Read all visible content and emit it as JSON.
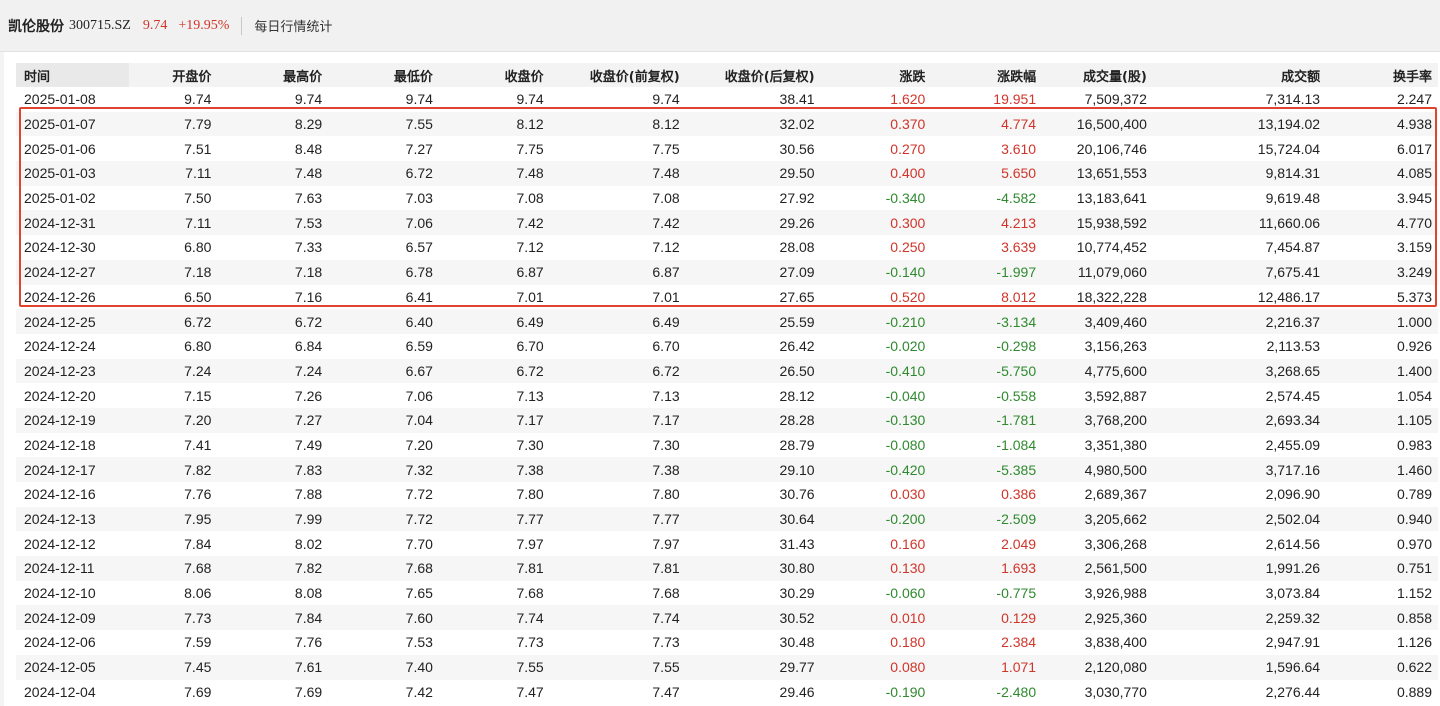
{
  "header": {
    "stock_name": "凯伦股份",
    "stock_code": "300715.SZ",
    "price": "9.74",
    "change_pct": "+19.95%",
    "tab_label": "每日行情统计"
  },
  "colors": {
    "up": "#d0352a",
    "down": "#2f8a2f",
    "highlight": "#e0442e"
  },
  "table": {
    "columns": [
      "时间",
      "开盘价",
      "最高价",
      "最低价",
      "收盘价",
      "收盘价(前复权)",
      "收盘价(后复权)",
      "涨跌",
      "涨跌幅",
      "成交量(股)",
      "成交额",
      "换手率"
    ],
    "rows": [
      [
        "2025-01-08",
        "9.74",
        "9.74",
        "9.74",
        "9.74",
        "9.74",
        "38.41",
        "1.620",
        "19.951",
        "7,509,372",
        "7,314.13",
        "2.247"
      ],
      [
        "2025-01-07",
        "7.79",
        "8.29",
        "7.55",
        "8.12",
        "8.12",
        "32.02",
        "0.370",
        "4.774",
        "16,500,400",
        "13,194.02",
        "4.938"
      ],
      [
        "2025-01-06",
        "7.51",
        "8.48",
        "7.27",
        "7.75",
        "7.75",
        "30.56",
        "0.270",
        "3.610",
        "20,106,746",
        "15,724.04",
        "6.017"
      ],
      [
        "2025-01-03",
        "7.11",
        "7.48",
        "6.72",
        "7.48",
        "7.48",
        "29.50",
        "0.400",
        "5.650",
        "13,651,553",
        "9,814.31",
        "4.085"
      ],
      [
        "2025-01-02",
        "7.50",
        "7.63",
        "7.03",
        "7.08",
        "7.08",
        "27.92",
        "-0.340",
        "-4.582",
        "13,183,641",
        "9,619.48",
        "3.945"
      ],
      [
        "2024-12-31",
        "7.11",
        "7.53",
        "7.06",
        "7.42",
        "7.42",
        "29.26",
        "0.300",
        "4.213",
        "15,938,592",
        "11,660.06",
        "4.770"
      ],
      [
        "2024-12-30",
        "6.80",
        "7.33",
        "6.57",
        "7.12",
        "7.12",
        "28.08",
        "0.250",
        "3.639",
        "10,774,452",
        "7,454.87",
        "3.159"
      ],
      [
        "2024-12-27",
        "7.18",
        "7.18",
        "6.78",
        "6.87",
        "6.87",
        "27.09",
        "-0.140",
        "-1.997",
        "11,079,060",
        "7,675.41",
        "3.249"
      ],
      [
        "2024-12-26",
        "6.50",
        "7.16",
        "6.41",
        "7.01",
        "7.01",
        "27.65",
        "0.520",
        "8.012",
        "18,322,228",
        "12,486.17",
        "5.373"
      ],
      [
        "2024-12-25",
        "6.72",
        "6.72",
        "6.40",
        "6.49",
        "6.49",
        "25.59",
        "-0.210",
        "-3.134",
        "3,409,460",
        "2,216.37",
        "1.000"
      ],
      [
        "2024-12-24",
        "6.80",
        "6.84",
        "6.59",
        "6.70",
        "6.70",
        "26.42",
        "-0.020",
        "-0.298",
        "3,156,263",
        "2,113.53",
        "0.926"
      ],
      [
        "2024-12-23",
        "7.24",
        "7.24",
        "6.67",
        "6.72",
        "6.72",
        "26.50",
        "-0.410",
        "-5.750",
        "4,775,600",
        "3,268.65",
        "1.400"
      ],
      [
        "2024-12-20",
        "7.15",
        "7.26",
        "7.06",
        "7.13",
        "7.13",
        "28.12",
        "-0.040",
        "-0.558",
        "3,592,887",
        "2,574.45",
        "1.054"
      ],
      [
        "2024-12-19",
        "7.20",
        "7.27",
        "7.04",
        "7.17",
        "7.17",
        "28.28",
        "-0.130",
        "-1.781",
        "3,768,200",
        "2,693.34",
        "1.105"
      ],
      [
        "2024-12-18",
        "7.41",
        "7.49",
        "7.20",
        "7.30",
        "7.30",
        "28.79",
        "-0.080",
        "-1.084",
        "3,351,380",
        "2,455.09",
        "0.983"
      ],
      [
        "2024-12-17",
        "7.82",
        "7.83",
        "7.32",
        "7.38",
        "7.38",
        "29.10",
        "-0.420",
        "-5.385",
        "4,980,500",
        "3,717.16",
        "1.460"
      ],
      [
        "2024-12-16",
        "7.76",
        "7.88",
        "7.72",
        "7.80",
        "7.80",
        "30.76",
        "0.030",
        "0.386",
        "2,689,367",
        "2,096.90",
        "0.789"
      ],
      [
        "2024-12-13",
        "7.95",
        "7.99",
        "7.72",
        "7.77",
        "7.77",
        "30.64",
        "-0.200",
        "-2.509",
        "3,205,662",
        "2,502.04",
        "0.940"
      ],
      [
        "2024-12-12",
        "7.84",
        "8.02",
        "7.70",
        "7.97",
        "7.97",
        "31.43",
        "0.160",
        "2.049",
        "3,306,268",
        "2,614.56",
        "0.970"
      ],
      [
        "2024-12-11",
        "7.68",
        "7.82",
        "7.68",
        "7.81",
        "7.81",
        "30.80",
        "0.130",
        "1.693",
        "2,561,500",
        "1,991.26",
        "0.751"
      ],
      [
        "2024-12-10",
        "8.06",
        "8.08",
        "7.65",
        "7.68",
        "7.68",
        "30.29",
        "-0.060",
        "-0.775",
        "3,926,988",
        "3,073.84",
        "1.152"
      ],
      [
        "2024-12-09",
        "7.73",
        "7.84",
        "7.60",
        "7.74",
        "7.74",
        "30.52",
        "0.010",
        "0.129",
        "2,925,360",
        "2,259.32",
        "0.858"
      ],
      [
        "2024-12-06",
        "7.59",
        "7.76",
        "7.53",
        "7.73",
        "7.73",
        "30.48",
        "0.180",
        "2.384",
        "3,838,400",
        "2,947.91",
        "1.126"
      ],
      [
        "2024-12-05",
        "7.45",
        "7.61",
        "7.40",
        "7.55",
        "7.55",
        "29.77",
        "0.080",
        "1.071",
        "2,120,080",
        "1,596.64",
        "0.622"
      ],
      [
        "2024-12-04",
        "7.69",
        "7.69",
        "7.42",
        "7.47",
        "7.47",
        "29.46",
        "-0.190",
        "-2.480",
        "3,030,770",
        "2,276.44",
        "0.889"
      ]
    ]
  }
}
